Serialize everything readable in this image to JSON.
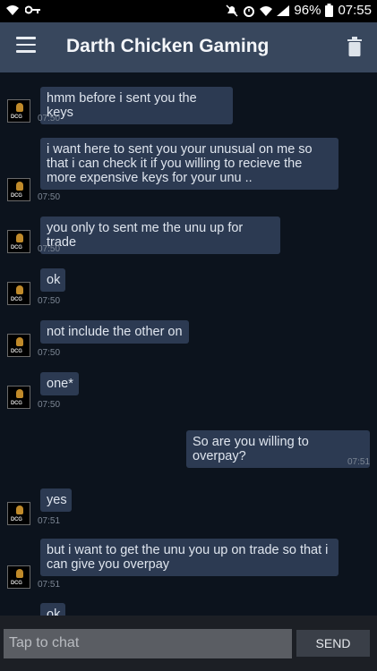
{
  "status_bar": {
    "battery": "96%",
    "time": "07:55"
  },
  "header": {
    "title": "Darth Chicken Gaming"
  },
  "avatar_text": "DCG",
  "messages": [
    {
      "text_lines": [
        "hmm before i sent you the keys"
      ],
      "time": "07:50"
    },
    {
      "text_lines": [
        "i want here to sent you your unusual on me so",
        "that i can check it if you willing to recieve the",
        "more expensive keys for your unu .."
      ],
      "time": "07:50"
    },
    {
      "text_lines": [
        "you only to sent me the unu up for trade"
      ],
      "time": "07:50"
    },
    {
      "text_lines": [
        "ok"
      ],
      "time": "07:50"
    },
    {
      "text_lines": [
        "not include the other on"
      ],
      "time": "07:50"
    },
    {
      "text_lines": [
        "one*"
      ],
      "time": "07:50"
    },
    {
      "text_lines": [
        "So are you willing to overpay?"
      ],
      "time": "07:51"
    },
    {
      "text_lines": [
        "yes"
      ],
      "time": "07:51"
    },
    {
      "text_lines": [
        "but i want to get the unu you up on trade so that i",
        "can give you overpay"
      ],
      "time": "07:51"
    },
    {
      "text_lines": [
        "ok"
      ],
      "time": ""
    }
  ],
  "composer": {
    "placeholder": "Tap to chat",
    "send_label": "SEND"
  }
}
